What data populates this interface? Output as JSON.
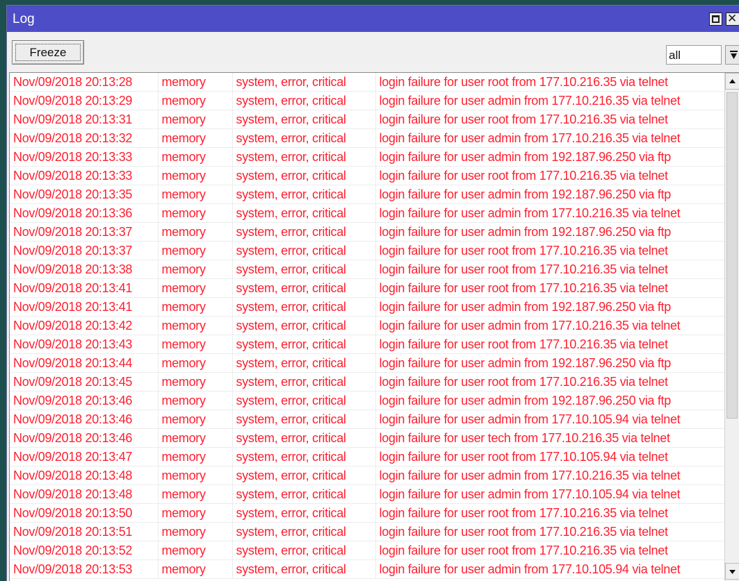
{
  "window": {
    "title": "Log"
  },
  "toolbar": {
    "freeze_label": "Freeze",
    "filter_value": "all"
  },
  "colors": {
    "titlebar": "#4d4dc8",
    "error_text": "#ff1f2f"
  },
  "icons": {
    "maximize": "maximize-icon",
    "close": "close-icon",
    "dropdown": "dropdown-arrow-icon",
    "scroll_up": "scroll-up-icon",
    "scroll_down": "scroll-down-icon"
  },
  "log": {
    "rows": [
      {
        "time": "Nov/09/2018 20:13:28",
        "topic1": "memory",
        "topic2": "system, error, critical",
        "message": "login failure for user root from 177.10.216.35 via telnet"
      },
      {
        "time": "Nov/09/2018 20:13:29",
        "topic1": "memory",
        "topic2": "system, error, critical",
        "message": "login failure for user admin from 177.10.216.35 via telnet"
      },
      {
        "time": "Nov/09/2018 20:13:31",
        "topic1": "memory",
        "topic2": "system, error, critical",
        "message": "login failure for user root from 177.10.216.35 via telnet"
      },
      {
        "time": "Nov/09/2018 20:13:32",
        "topic1": "memory",
        "topic2": "system, error, critical",
        "message": "login failure for user admin from 177.10.216.35 via telnet"
      },
      {
        "time": "Nov/09/2018 20:13:33",
        "topic1": "memory",
        "topic2": "system, error, critical",
        "message": "login failure for user admin from 192.187.96.250 via ftp"
      },
      {
        "time": "Nov/09/2018 20:13:33",
        "topic1": "memory",
        "topic2": "system, error, critical",
        "message": "login failure for user root from 177.10.216.35 via telnet"
      },
      {
        "time": "Nov/09/2018 20:13:35",
        "topic1": "memory",
        "topic2": "system, error, critical",
        "message": "login failure for user admin from 192.187.96.250 via ftp"
      },
      {
        "time": "Nov/09/2018 20:13:36",
        "topic1": "memory",
        "topic2": "system, error, critical",
        "message": "login failure for user admin from 177.10.216.35 via telnet"
      },
      {
        "time": "Nov/09/2018 20:13:37",
        "topic1": "memory",
        "topic2": "system, error, critical",
        "message": "login failure for user admin from 192.187.96.250 via ftp"
      },
      {
        "time": "Nov/09/2018 20:13:37",
        "topic1": "memory",
        "topic2": "system, error, critical",
        "message": "login failure for user root from 177.10.216.35 via telnet"
      },
      {
        "time": "Nov/09/2018 20:13:38",
        "topic1": "memory",
        "topic2": "system, error, critical",
        "message": "login failure for user root from 177.10.216.35 via telnet"
      },
      {
        "time": "Nov/09/2018 20:13:41",
        "topic1": "memory",
        "topic2": "system, error, critical",
        "message": "login failure for user root from 177.10.216.35 via telnet"
      },
      {
        "time": "Nov/09/2018 20:13:41",
        "topic1": "memory",
        "topic2": "system, error, critical",
        "message": "login failure for user admin from 192.187.96.250 via ftp"
      },
      {
        "time": "Nov/09/2018 20:13:42",
        "topic1": "memory",
        "topic2": "system, error, critical",
        "message": "login failure for user admin from 177.10.216.35 via telnet"
      },
      {
        "time": "Nov/09/2018 20:13:43",
        "topic1": "memory",
        "topic2": "system, error, critical",
        "message": "login failure for user root from 177.10.216.35 via telnet"
      },
      {
        "time": "Nov/09/2018 20:13:44",
        "topic1": "memory",
        "topic2": "system, error, critical",
        "message": "login failure for user admin from 192.187.96.250 via ftp"
      },
      {
        "time": "Nov/09/2018 20:13:45",
        "topic1": "memory",
        "topic2": "system, error, critical",
        "message": "login failure for user root from 177.10.216.35 via telnet"
      },
      {
        "time": "Nov/09/2018 20:13:46",
        "topic1": "memory",
        "topic2": "system, error, critical",
        "message": "login failure for user admin from 192.187.96.250 via ftp"
      },
      {
        "time": "Nov/09/2018 20:13:46",
        "topic1": "memory",
        "topic2": "system, error, critical",
        "message": "login failure for user admin from 177.10.105.94 via telnet"
      },
      {
        "time": "Nov/09/2018 20:13:46",
        "topic1": "memory",
        "topic2": "system, error, critical",
        "message": "login failure for user tech from 177.10.216.35 via telnet"
      },
      {
        "time": "Nov/09/2018 20:13:47",
        "topic1": "memory",
        "topic2": "system, error, critical",
        "message": "login failure for user root from 177.10.105.94 via telnet"
      },
      {
        "time": "Nov/09/2018 20:13:48",
        "topic1": "memory",
        "topic2": "system, error, critical",
        "message": "login failure for user admin from 177.10.216.35 via telnet"
      },
      {
        "time": "Nov/09/2018 20:13:48",
        "topic1": "memory",
        "topic2": "system, error, critical",
        "message": "login failure for user admin from 177.10.105.94 via telnet"
      },
      {
        "time": "Nov/09/2018 20:13:50",
        "topic1": "memory",
        "topic2": "system, error, critical",
        "message": "login failure for user root from 177.10.216.35 via telnet"
      },
      {
        "time": "Nov/09/2018 20:13:51",
        "topic1": "memory",
        "topic2": "system, error, critical",
        "message": "login failure for user root from 177.10.216.35 via telnet"
      },
      {
        "time": "Nov/09/2018 20:13:52",
        "topic1": "memory",
        "topic2": "system, error, critical",
        "message": "login failure for user root from 177.10.216.35 via telnet"
      },
      {
        "time": "Nov/09/2018 20:13:53",
        "topic1": "memory",
        "topic2": "system, error, critical",
        "message": "login failure for user admin from 177.10.105.94 via telnet"
      }
    ]
  }
}
